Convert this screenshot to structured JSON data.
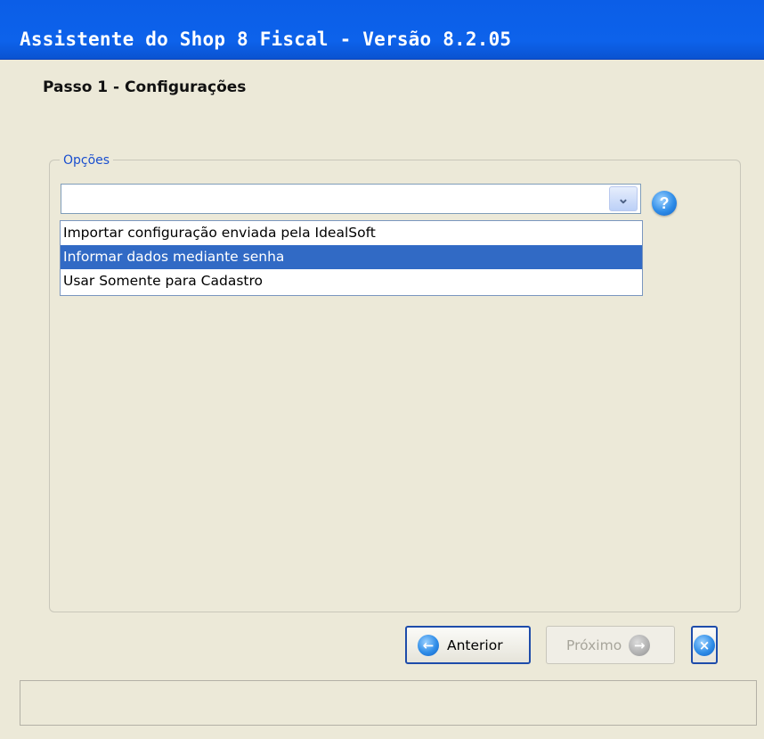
{
  "window": {
    "title": "Assistente do Shop 8 Fiscal - Versão 8.2.05"
  },
  "step": {
    "title": "Passo 1 - Configurações"
  },
  "options": {
    "group_label": "Opções",
    "combo_value": "",
    "help_glyph": "?",
    "dropdown_items": [
      "Importar configuração enviada pela IdealSoft",
      "Informar dados mediante senha",
      "Usar Somente para Cadastro"
    ],
    "selected_index": 1
  },
  "buttons": {
    "previous_label": "Anterior",
    "next_label": "Próximo"
  },
  "icons": {
    "combo_arrow": "chevron-down-icon",
    "help": "help-icon",
    "previous": "arrow-left-circle-icon",
    "next": "arrow-right-circle-icon",
    "close": "close-circle-icon"
  },
  "colors": {
    "titlebar": "#0b5ee7",
    "selection": "#316ac5",
    "legend_text": "#1a4fcf"
  }
}
